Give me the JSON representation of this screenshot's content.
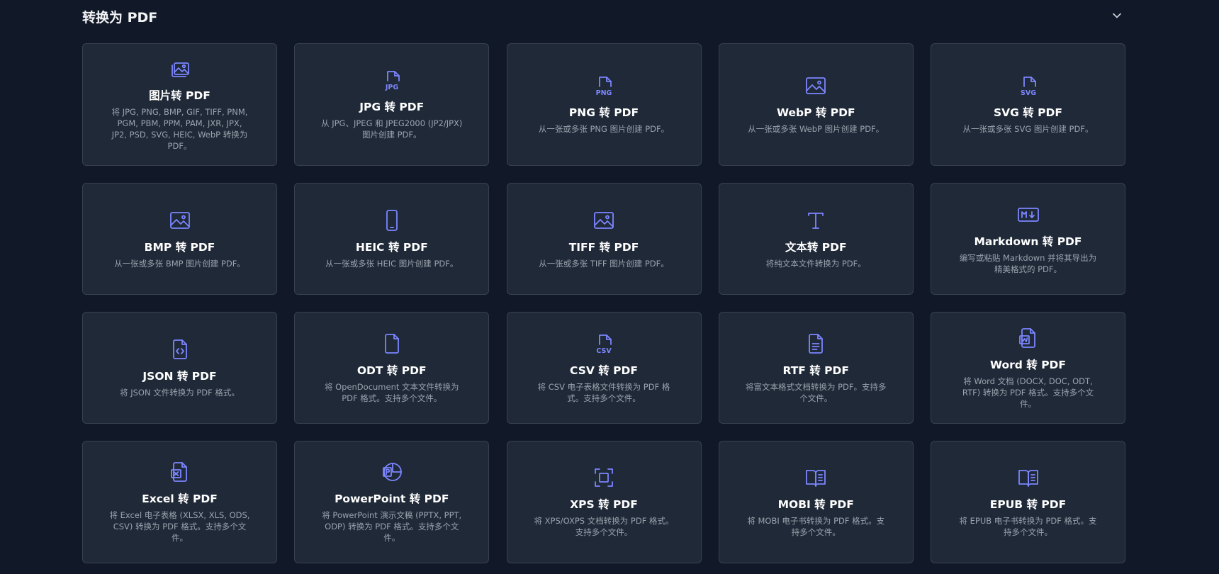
{
  "section": {
    "title": "转换为 PDF",
    "collapse_icon": "chevron-down-icon"
  },
  "colors": {
    "background": "#111827",
    "card_background": "#1f2937",
    "card_border": "#374151",
    "icon_accent": "#7c86ff",
    "title_text": "#ffffff",
    "description_text": "#9ca3af"
  },
  "cards": [
    {
      "icon": "images-icon",
      "title": "图片转 PDF",
      "description": "将 JPG, PNG, BMP, GIF, TIFF, PNM, PGM, PBM, PPM, PAM, JXR, JPX, JP2, PSD, SVG, HEIC, WebP 转换为 PDF。"
    },
    {
      "icon": "jpg-file-icon",
      "title": "JPG 转 PDF",
      "description": "从 JPG、JPEG 和 JPEG2000 (JP2/JPX) 图片创建 PDF。"
    },
    {
      "icon": "png-file-icon",
      "title": "PNG 转 PDF",
      "description": "从一张或多张 PNG 图片创建 PDF。"
    },
    {
      "icon": "image-icon",
      "title": "WebP 转 PDF",
      "description": "从一张或多张 WebP 图片创建 PDF。"
    },
    {
      "icon": "svg-file-icon",
      "title": "SVG 转 PDF",
      "description": "从一张或多张 SVG 图片创建 PDF。"
    },
    {
      "icon": "image-icon",
      "title": "BMP 转 PDF",
      "description": "从一张或多张 BMP 图片创建 PDF。"
    },
    {
      "icon": "smartphone-icon",
      "title": "HEIC 转 PDF",
      "description": "从一张或多张 HEIC 图片创建 PDF。"
    },
    {
      "icon": "image-icon",
      "title": "TIFF 转 PDF",
      "description": "从一张或多张 TIFF 图片创建 PDF。"
    },
    {
      "icon": "text-type-icon",
      "title": "文本转 PDF",
      "description": "将纯文本文件转换为 PDF。"
    },
    {
      "icon": "markdown-icon",
      "title": "Markdown 转 PDF",
      "description": "编写或粘贴 Markdown 并将其导出为精美格式的 PDF。"
    },
    {
      "icon": "code-file-icon",
      "title": "JSON 转 PDF",
      "description": "将 JSON 文件转换为 PDF 格式。"
    },
    {
      "icon": "file-icon",
      "title": "ODT 转 PDF",
      "description": "将 OpenDocument 文本文件转换为 PDF 格式。支持多个文件。"
    },
    {
      "icon": "csv-file-icon",
      "title": "CSV 转 PDF",
      "description": "将 CSV 电子表格文件转换为 PDF 格式。支持多个文件。"
    },
    {
      "icon": "text-file-icon",
      "title": "RTF 转 PDF",
      "description": "将富文本格式文档转换为 PDF。支持多个文件。"
    },
    {
      "icon": "word-file-icon",
      "title": "Word 转 PDF",
      "description": "将 Word 文档 (DOCX, DOC, ODT, RTF) 转换为 PDF 格式。支持多个文件。"
    },
    {
      "icon": "excel-file-icon",
      "title": "Excel 转 PDF",
      "description": "将 Excel 电子表格 (XLSX, XLS, ODS, CSV) 转换为 PDF 格式。支持多个文件。"
    },
    {
      "icon": "powerpoint-file-icon",
      "title": "PowerPoint 转 PDF",
      "description": "将 PowerPoint 演示文稿 (PPTX, PPT, ODP) 转换为 PDF 格式。支持多个文件。"
    },
    {
      "icon": "scan-icon",
      "title": "XPS 转 PDF",
      "description": "将 XPS/OXPS 文档转换为 PDF 格式。支持多个文件。"
    },
    {
      "icon": "book-open-icon",
      "title": "MOBI 转 PDF",
      "description": "将 MOBI 电子书转换为 PDF 格式。支持多个文件。"
    },
    {
      "icon": "book-open-icon",
      "title": "EPUB 转 PDF",
      "description": "将 EPUB 电子书转换为 PDF 格式。支持多个文件。"
    }
  ]
}
